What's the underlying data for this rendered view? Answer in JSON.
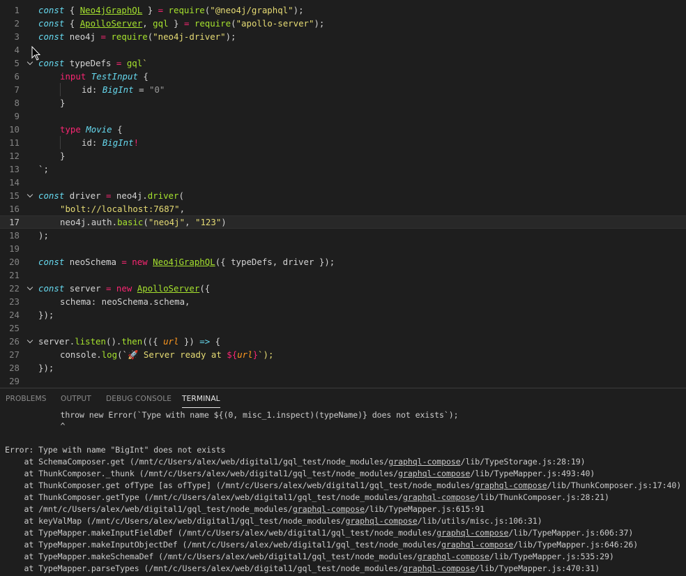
{
  "editor": {
    "line_numbers": [
      "1",
      "2",
      "3",
      "4",
      "5",
      "6",
      "7",
      "8",
      "9",
      "10",
      "11",
      "12",
      "13",
      "14",
      "15",
      "16",
      "17",
      "18",
      "19",
      "20",
      "21",
      "22",
      "23",
      "24",
      "25",
      "26",
      "27",
      "28",
      "29"
    ],
    "current_line": "17"
  },
  "panel": {
    "tabs": [
      {
        "label": "PROBLEMS",
        "active": false
      },
      {
        "label": "OUTPUT",
        "active": false
      },
      {
        "label": "DEBUG CONSOLE",
        "active": false
      },
      {
        "label": "TERMINAL",
        "active": true
      }
    ]
  },
  "terminal": {
    "line1": "    throw new Error(`Type with name ${(0, misc_1.inspect)(typeName)} does not exists`);",
    "line2": "    ^",
    "error": "Error: Type with name \"BigInt\" does not exists",
    "stack": [
      {
        "pre": "    at SchemaComposer.get (/mnt/c/Users/alex/web/digital1/gql_test/node_modules/",
        "pkg": "graphql-compose",
        "post": "/lib/TypeStorage.js:28:19)"
      },
      {
        "pre": "    at ThunkComposer._thunk (/mnt/c/Users/alex/web/digital1/gql_test/node_modules/",
        "pkg": "graphql-compose",
        "post": "/lib/TypeMapper.js:493:40)"
      },
      {
        "pre": "    at ThunkComposer.get ofType [as ofType] (/mnt/c/Users/alex/web/digital1/gql_test/node_modules/",
        "pkg": "graphql-compose",
        "post": "/lib/ThunkComposer.js:17:40)"
      },
      {
        "pre": "    at ThunkComposer.getType (/mnt/c/Users/alex/web/digital1/gql_test/node_modules/",
        "pkg": "graphql-compose",
        "post": "/lib/ThunkComposer.js:28:21)"
      },
      {
        "pre": "    at /mnt/c/Users/alex/web/digital1/gql_test/node_modules/",
        "pkg": "graphql-compose",
        "post": "/lib/TypeMapper.js:615:91"
      },
      {
        "pre": "    at keyValMap (/mnt/c/Users/alex/web/digital1/gql_test/node_modules/",
        "pkg": "graphql-compose",
        "post": "/lib/utils/misc.js:106:31)"
      },
      {
        "pre": "    at TypeMapper.makeInputFieldDef (/mnt/c/Users/alex/web/digital1/gql_test/node_modules/",
        "pkg": "graphql-compose",
        "post": "/lib/TypeMapper.js:606:37)"
      },
      {
        "pre": "    at TypeMapper.makeInputObjectDef (/mnt/c/Users/alex/web/digital1/gql_test/node_modules/",
        "pkg": "graphql-compose",
        "post": "/lib/TypeMapper.js:646:26)"
      },
      {
        "pre": "    at TypeMapper.makeSchemaDef (/mnt/c/Users/alex/web/digital1/gql_test/node_modules/",
        "pkg": "graphql-compose",
        "post": "/lib/TypeMapper.js:535:29)"
      },
      {
        "pre": "    at TypeMapper.parseTypes (/mnt/c/Users/alex/web/digital1/gql_test/node_modules/",
        "pkg": "graphql-compose",
        "post": "/lib/TypeMapper.js:470:31)"
      }
    ]
  },
  "code": {
    "l1": {
      "t1": "const",
      "t2": " { ",
      "t3": "Neo4jGraphQL",
      "t4": " } ",
      "t5": "=",
      "t6": " require",
      "t7": "(",
      "t8": "\"@neo4j/graphql\"",
      "t9": ");"
    },
    "l2": {
      "t1": "const",
      "t2": " { ",
      "t3": "ApolloServer",
      "t4": ", ",
      "t5": "gql",
      "t6": " } ",
      "t7": "=",
      "t8": " require",
      "t9": "(",
      "t10": "\"apollo-server\"",
      "t11": ");"
    },
    "l3": {
      "t1": "const",
      "t2": " neo4j ",
      "t3": "=",
      "t4": " require",
      "t5": "(",
      "t6": "\"neo4j-driver\"",
      "t7": ");"
    },
    "l5": {
      "t1": "const",
      "t2": " typeDefs ",
      "t3": "=",
      "t4": " gql",
      "t5": "`"
    },
    "l6": {
      "t1": "input",
      "t2": " TestInput",
      "t3": " {"
    },
    "l7": {
      "t1": "id: ",
      "t2": "BigInt",
      "t3": " = ",
      "t4": "\"0\""
    },
    "l8": {
      "t1": "}"
    },
    "l10": {
      "t1": "type",
      "t2": " Movie",
      "t3": " {"
    },
    "l11": {
      "t1": "id: ",
      "t2": "BigInt",
      "t3": "!"
    },
    "l12": {
      "t1": "}"
    },
    "l13": {
      "t1": "`;"
    },
    "l15": {
      "t1": "const",
      "t2": " driver ",
      "t3": "=",
      "t4": " neo4j.",
      "t5": "driver",
      "t6": "("
    },
    "l16": {
      "t1": "\"bolt://localhost:7687\"",
      "t2": ","
    },
    "l17": {
      "t1": "neo4j.auth.",
      "t2": "basic",
      "t3": "(",
      "t4": "\"neo4j\"",
      "t5": ", ",
      "t6": "\"123\"",
      "t7": ")"
    },
    "l18": {
      "t1": ");"
    },
    "l20": {
      "t1": "const",
      "t2": " neoSchema ",
      "t3": "=",
      "t4": " new",
      "t5": " ",
      "t6": "Neo4jGraphQL",
      "t7": "({ typeDefs, driver });"
    },
    "l22": {
      "t1": "const",
      "t2": " server ",
      "t3": "=",
      "t4": " new",
      "t5": " ",
      "t6": "ApolloServer",
      "t7": "({"
    },
    "l23": {
      "t1": "schema: neoSchema.schema,"
    },
    "l24": {
      "t1": "});"
    },
    "l26": {
      "t1": "server.",
      "t2": "listen",
      "t3": "().",
      "t4": "then",
      "t5": "(({ ",
      "t6": "url",
      "t7": " }) ",
      "t8": "=>",
      "t9": " {"
    },
    "l27": {
      "t1": "console.",
      "t2": "log",
      "t3": "(`",
      "t4": "🚀",
      "t5": " Server ready at ",
      "t6": "${",
      "t7": "url",
      "t8": "}",
      "t9": "`);"
    },
    "l28": {
      "t1": "});"
    }
  }
}
